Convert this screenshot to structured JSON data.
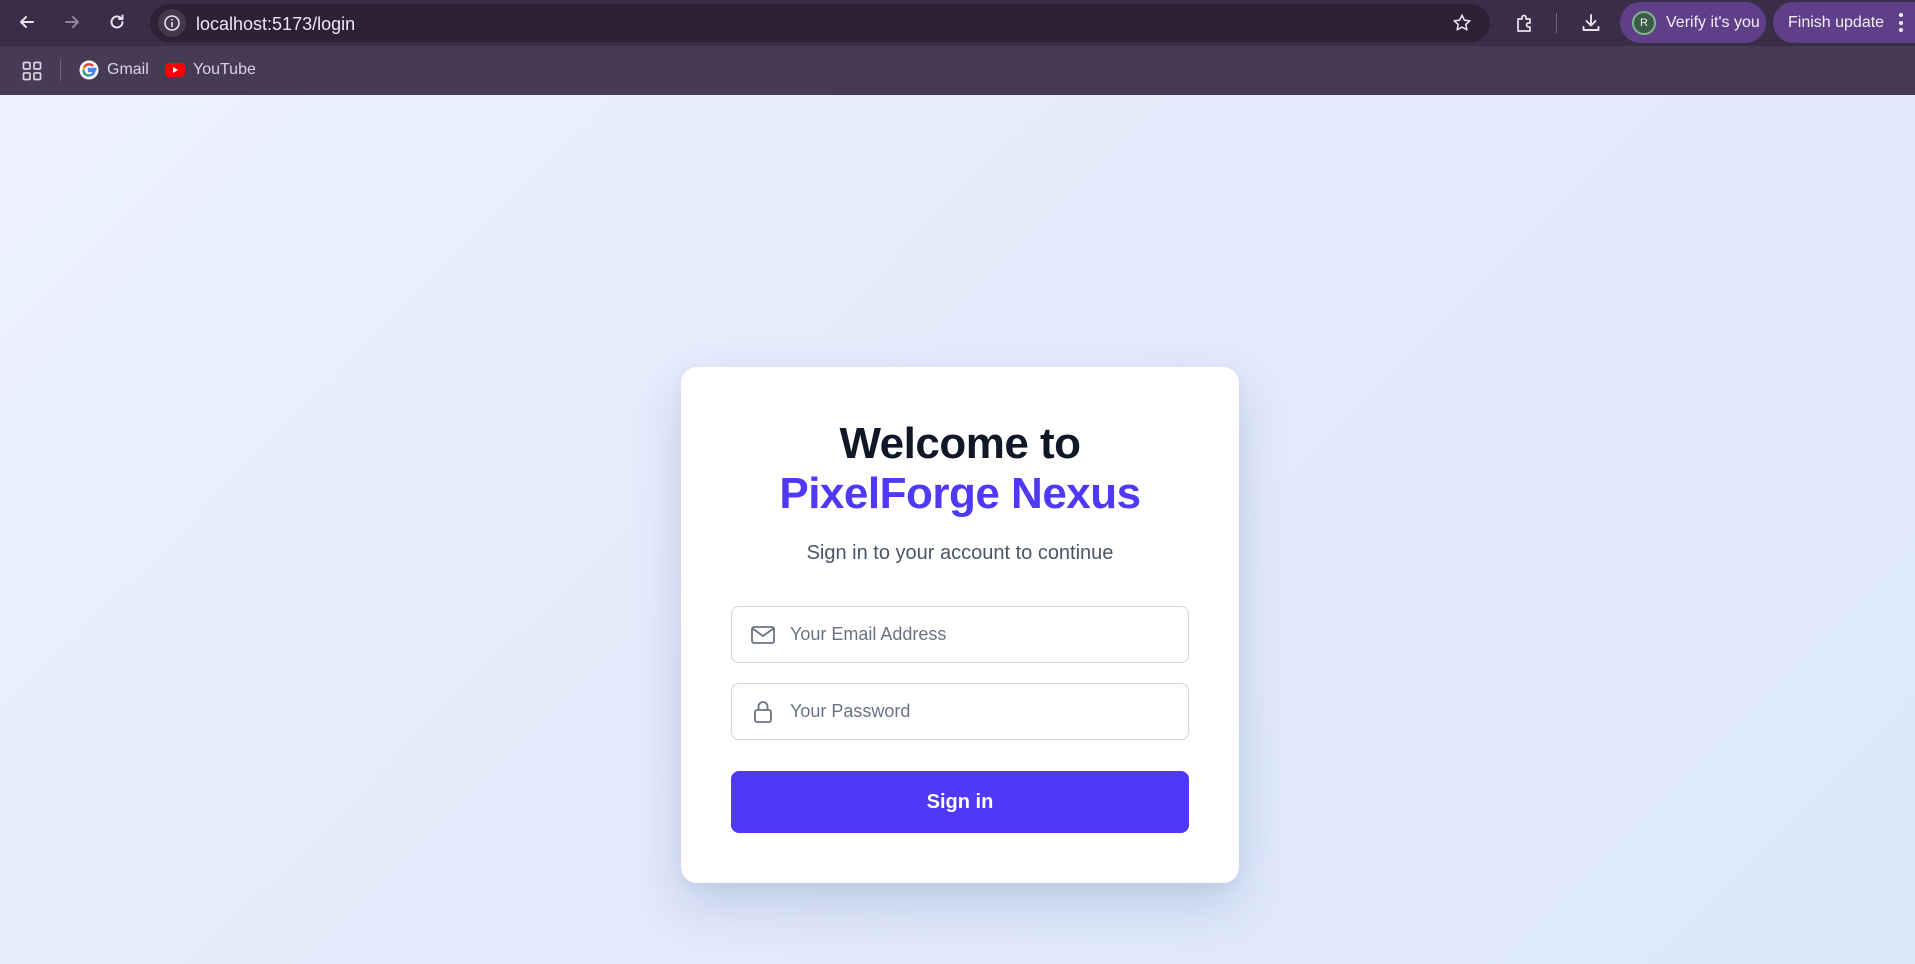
{
  "browser": {
    "url": "localhost:5173/login",
    "verify_label": "Verify it's you",
    "avatar_initial": "R",
    "finish_update_label": "Finish update",
    "bookmarks": [
      {
        "label": "Gmail",
        "icon": "gmail-icon"
      },
      {
        "label": "YouTube",
        "icon": "youtube-icon"
      }
    ]
  },
  "login": {
    "title_line1": "Welcome to",
    "title_line2": "PixelForge Nexus",
    "subtitle": "Sign in to your account to continue",
    "email_placeholder": "Your Email Address",
    "email_value": "",
    "password_placeholder": "Your Password",
    "password_value": "",
    "submit_label": "Sign in"
  },
  "colors": {
    "accent": "#4f39f6",
    "heading": "#101828",
    "browser_frame": "#3a2d48",
    "update_pill": "#5e3f88"
  }
}
